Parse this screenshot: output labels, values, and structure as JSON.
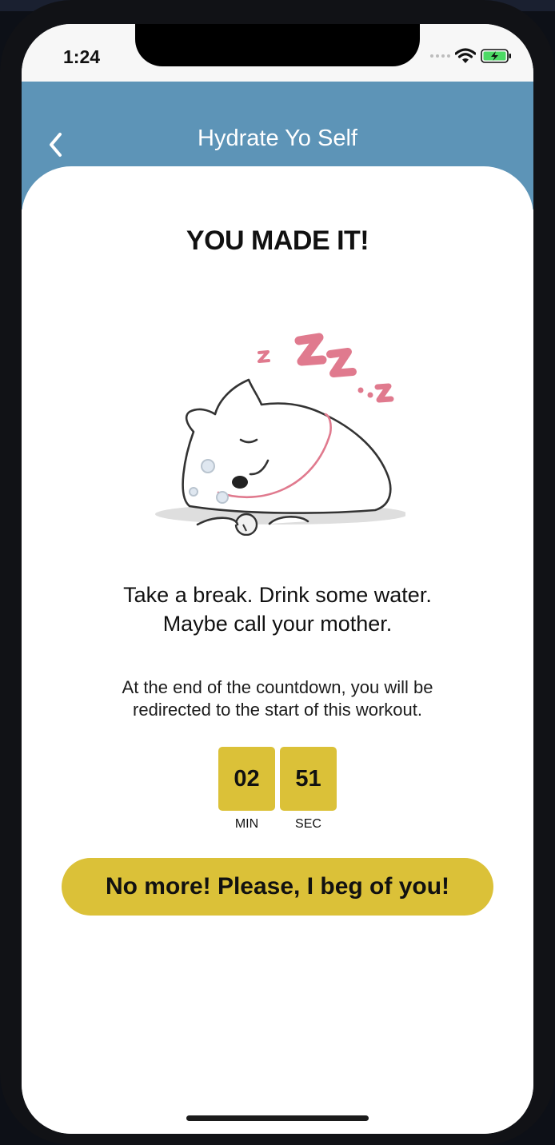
{
  "status_bar": {
    "time": "1:24"
  },
  "nav": {
    "title": "Hydrate Yo Self"
  },
  "main": {
    "heading": "YOU MADE IT!",
    "message_line1": "Take a break. Drink some water.",
    "message_line2": "Maybe call your mother.",
    "info_line1": "At the end of the countdown, you will be",
    "info_line2": "redirected to the start of this workout.",
    "countdown": {
      "minutes": "02",
      "seconds": "51",
      "minutes_label": "MIN",
      "seconds_label": "SEC"
    },
    "cta_label": "No more! Please, I beg of you!"
  },
  "icons": [
    "back-chevron-icon",
    "wifi-icon",
    "battery-charging-icon",
    "cellular-signal-icon",
    "sleeping-cat-illustration"
  ],
  "colors": {
    "nav_background": "#5d94b7",
    "accent_yellow": "#dbc138",
    "zzz_pink": "#e07a8e",
    "battery_green": "#4cd964"
  }
}
